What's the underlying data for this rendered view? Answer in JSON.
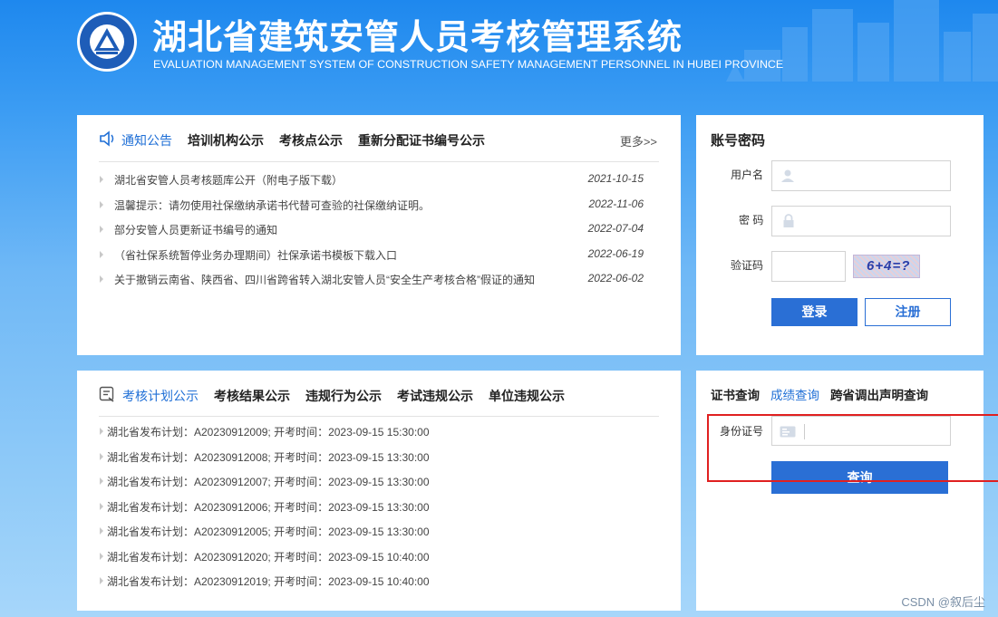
{
  "header": {
    "title_cn": "湖北省建筑安管人员考核管理系统",
    "title_en": "EVALUATION MANAGEMENT SYSTEM OF CONSTRUCTION SAFETY MANAGEMENT PERSONNEL IN HUBEI PROVINCE"
  },
  "notice_panel": {
    "tabs": [
      "通知公告",
      "培训机构公示",
      "考核点公示",
      "重新分配证书编号公示"
    ],
    "more": "更多>>",
    "items": [
      {
        "text": "湖北省安管人员考核题库公开（附电子版下载）",
        "date": "2021-10-15"
      },
      {
        "text": "温馨提示：请勿使用社保缴纳承诺书代替可查验的社保缴纳证明。",
        "date": "2022-11-06"
      },
      {
        "text": "部分安管人员更新证书编号的通知",
        "date": "2022-07-04"
      },
      {
        "text": "（省社保系统暂停业务办理期间）社保承诺书模板下载入口",
        "date": "2022-06-19"
      },
      {
        "text": "关于撤销云南省、陕西省、四川省跨省转入湖北安管人员“安全生产考核合格”假证的通知",
        "date": "2022-06-02"
      }
    ]
  },
  "plan_panel": {
    "tabs": [
      "考核计划公示",
      "考核结果公示",
      "违规行为公示",
      "考试违规公示",
      "单位违规公示"
    ],
    "items": [
      "湖北省发布计划：A20230912009; 开考时间：2023-09-15 15:30:00",
      "湖北省发布计划：A20230912008; 开考时间：2023-09-15 13:30:00",
      "湖北省发布计划：A20230912007; 开考时间：2023-09-15 13:30:00",
      "湖北省发布计划：A20230912006; 开考时间：2023-09-15 13:30:00",
      "湖北省发布计划：A20230912005; 开考时间：2023-09-15 13:30:00",
      "湖北省发布计划：A20230912020; 开考时间：2023-09-15 10:40:00",
      "湖北省发布计划：A20230912019; 开考时间：2023-09-15 10:40:00"
    ]
  },
  "login": {
    "heading": "账号密码",
    "username_label": "用户名",
    "password_label": "密 码",
    "captcha_label": "验证码",
    "captcha_text": "6+4=?",
    "login_button": "登录",
    "register_button": "注册"
  },
  "query": {
    "tabs": [
      "证书查询",
      "成绩查询",
      "跨省调出声明查询"
    ],
    "id_label": "身份证号",
    "query_button": "查询"
  },
  "watermark": "CSDN @叙后尘",
  "colors": {
    "accent": "#2a6fd5",
    "active_tab": "#1f6fd6",
    "highlight_box": "#e02020"
  }
}
